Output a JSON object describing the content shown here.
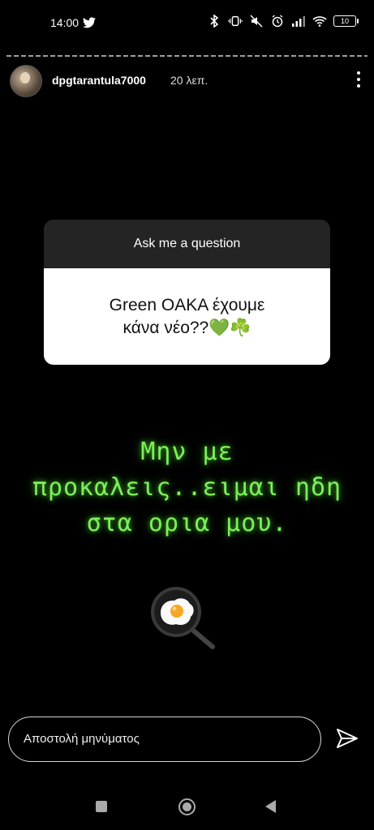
{
  "status_bar": {
    "time": "14:00",
    "battery": "10",
    "icons": [
      "twitter-icon",
      "bluetooth-icon",
      "vibrate-icon",
      "mute-icon",
      "alarm-icon",
      "signal-icon",
      "wifi-icon",
      "battery-icon"
    ]
  },
  "story": {
    "username": "dpgtarantula7000",
    "time_ago": "20 λεπ.",
    "question": {
      "header": "Ask me a question",
      "line1": "Green OAKA έχουμε",
      "line2": "κάνα νέο??",
      "emojis": "💚☘️"
    },
    "neon_text": {
      "line1": "Μην με",
      "line2": "προκαλεις..ειμαι ηδη",
      "line3": "στα ορια μου."
    },
    "sticker_icon": "fried-egg-pan-icon"
  },
  "reply": {
    "placeholder": "Αποστολή μηνύματος"
  },
  "colors": {
    "neon": "#7df05a",
    "background": "#000000",
    "card_header": "#242424"
  }
}
